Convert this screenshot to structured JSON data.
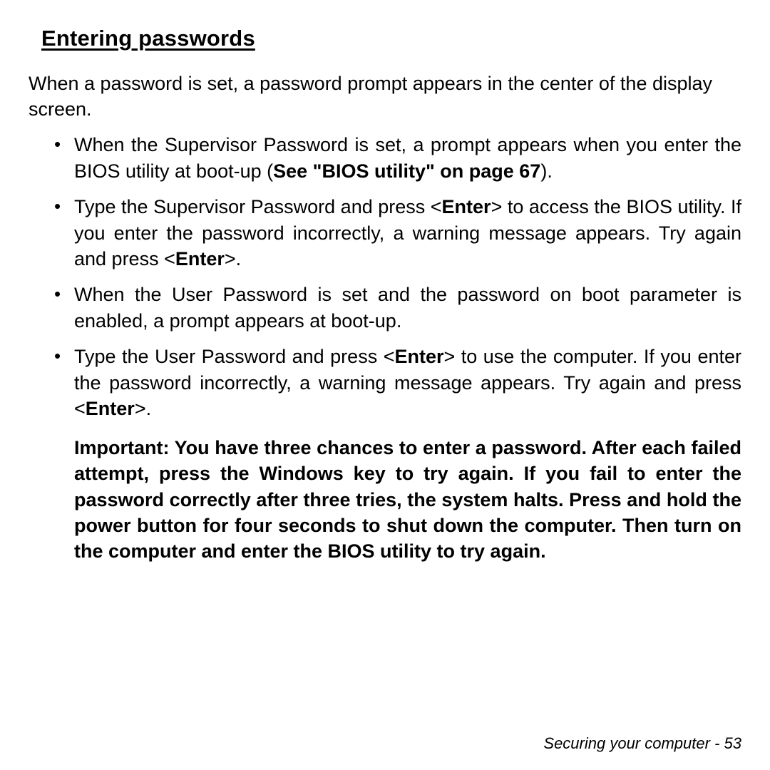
{
  "heading": "Entering passwords",
  "intro": "When a password is set, a password prompt appears in the center of the display screen.",
  "bullets": [
    {
      "pre": "When the Supervisor Password is set, a prompt appears when you enter the BIOS utility at boot-up (",
      "bold": "See \"BIOS utility\" on page 67",
      "post": ")."
    },
    {
      "pre": "Type the Supervisor Password and press <",
      "bold": "Enter",
      "post": "> to access the BIOS utility. If you enter the password incorrectly, a warning message appears. Try again and press <",
      "bold2": "Enter",
      "post2": ">."
    },
    {
      "pre": "When the User Password is set and the password on boot parameter is enabled, a prompt appears at boot-up.",
      "bold": "",
      "post": ""
    },
    {
      "pre": "Type the User Password and press <",
      "bold": "Enter",
      "post": "> to use the computer. If you enter the password incorrectly, a warning message appears. Try again and press <",
      "bold2": "Enter",
      "post2": ">."
    }
  ],
  "important": "Important: You have three chances to enter a password. After each failed attempt, press the Windows key to try again. If you fail to enter the password correctly after three tries, the system halts. Press and hold the power button for four seconds to shut down the computer. Then turn on the computer and enter the BIOS utility to try again.",
  "footer_title": "Securing your computer",
  "footer_sep": " -  ",
  "footer_page": "53"
}
